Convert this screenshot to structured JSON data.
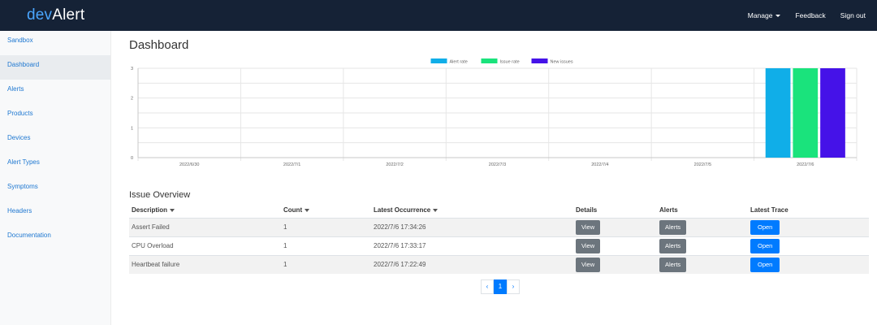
{
  "navbar": {
    "brand_dev": "dev",
    "brand_alert": "Alert",
    "manage_label": "Manage",
    "feedback_label": "Feedback",
    "signout_label": "Sign out",
    "background": "#152236"
  },
  "sidebar": {
    "items": [
      {
        "label": "Sandbox"
      },
      {
        "label": "Dashboard"
      },
      {
        "label": "Alerts"
      },
      {
        "label": "Products"
      },
      {
        "label": "Devices"
      },
      {
        "label": "Alert Types"
      },
      {
        "label": "Symptoms"
      },
      {
        "label": "Headers"
      },
      {
        "label": "Documentation"
      }
    ],
    "active_index": 1
  },
  "page_title": "Dashboard",
  "chart_data": {
    "type": "bar",
    "categories": [
      "2022/6/30",
      "2022/7/1",
      "2022/7/2",
      "2022/7/3",
      "2022/7/4",
      "2022/7/5",
      "2022/7/6"
    ],
    "series": [
      {
        "name": "Alert rate",
        "color": "#10aee8",
        "values": [
          0,
          0,
          0,
          0,
          0,
          0,
          3
        ]
      },
      {
        "name": "Issue rate",
        "color": "#1ae37c",
        "values": [
          0,
          0,
          0,
          0,
          0,
          0,
          3
        ]
      },
      {
        "name": "New issues",
        "color": "#4512e8",
        "values": [
          0,
          0,
          0,
          0,
          0,
          0,
          3
        ]
      }
    ],
    "ylim": [
      0,
      3
    ],
    "yticks": [
      0,
      1,
      2,
      3
    ],
    "legend": "top-center",
    "grid": true
  },
  "issues": {
    "title": "Issue Overview",
    "headers": {
      "description": "Description",
      "count": "Count",
      "latest_occurrence": "Latest Occurrence",
      "details": "Details",
      "alerts": "Alerts",
      "latest_trace": "Latest Trace"
    },
    "rows": [
      {
        "description": "Assert Failed",
        "count": "1",
        "latest": "2022/7/6 17:34:26",
        "details_btn": "View",
        "alerts_btn": "Alerts",
        "trace_btn": "Open"
      },
      {
        "description": "CPU Overload",
        "count": "1",
        "latest": "2022/7/6 17:33:17",
        "details_btn": "View",
        "alerts_btn": "Alerts",
        "trace_btn": "Open"
      },
      {
        "description": "Heartbeat failure",
        "count": "1",
        "latest": "2022/7/6 17:22:49",
        "details_btn": "View",
        "alerts_btn": "Alerts",
        "trace_btn": "Open"
      }
    ]
  },
  "pagination": {
    "prev": "‹",
    "current": "1",
    "next": "›"
  }
}
